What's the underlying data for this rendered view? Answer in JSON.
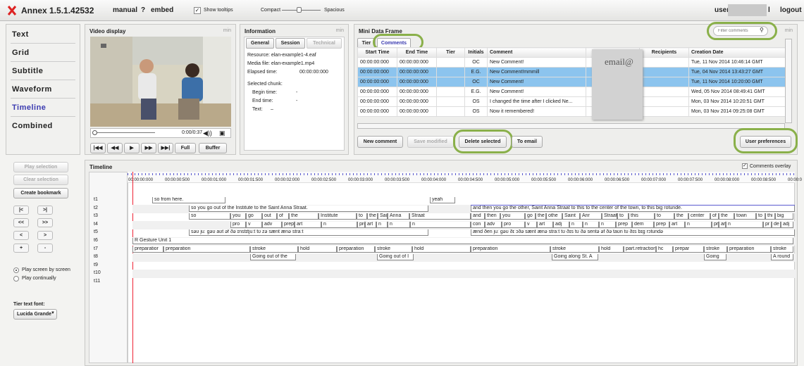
{
  "app": {
    "title": "Annex 1.5.1.42532",
    "manual": "manual",
    "help": "?",
    "embed": "embed",
    "show_tooltips": "Show tooltips",
    "compact": "Compact",
    "spacious": "Spacious",
    "user": "user",
    "user_suffix": "l",
    "logout": "logout"
  },
  "nav": [
    "Text",
    "Grid",
    "Subtitle",
    "Waveform",
    "Timeline",
    "Combined"
  ],
  "nav_active": "Timeline",
  "video": {
    "header": "Video display",
    "min": "min",
    "time": "0:00/0:37",
    "buttons": [
      "|◀◀",
      "◀◀",
      "▶",
      "▶▶",
      "▶▶|",
      "Full",
      "Buffer"
    ]
  },
  "info": {
    "header": "Information",
    "min": "min",
    "tabs": [
      "General",
      "Session",
      "Technical"
    ],
    "resource": "Resource:  elan-example1-4.eaf",
    "media": "Media file:  elan-example1.mp4",
    "elapsed_label": "Elapsed time:",
    "elapsed": "00:00:00:000",
    "chunk": "Selected chunk:",
    "begin": "Begin time:",
    "begin_val": "-",
    "end": "End time:",
    "end_val": "-",
    "text": "Text:",
    "text_val": "–"
  },
  "mdf": {
    "header": "Mini Data Frame",
    "min": "min",
    "filter_placeholder": "Filter comments",
    "tabs": [
      "Tier",
      "Comments"
    ],
    "columns": [
      "Start Time",
      "End Time",
      "Tier",
      "Initials",
      "Comment",
      "",
      "Recipients",
      "Creation Date"
    ],
    "rows": [
      [
        "00:00:00:000",
        "00:00:00:000",
        "",
        "OC",
        "New Comment!",
        "",
        "",
        "Tue, 11 Nov 2014 10:46:14 GMT"
      ],
      [
        "00:00:00:000",
        "00:00:00:000",
        "",
        "E.G.",
        "New Comment!mmmill",
        "",
        "",
        "Tue, 04 Nov 2014 13:43:27 GMT"
      ],
      [
        "00:00:00:000",
        "00:00:00:000",
        "",
        "OC",
        "New Comment!",
        "",
        "",
        "Tue, 11 Nov 2014 10:20:00 GMT"
      ],
      [
        "00:00:00:000",
        "00:00:00:000",
        "",
        "E.G.",
        "New Comment!",
        "",
        "",
        "Wed, 05 Nov 2014 08:49:41 GMT"
      ],
      [
        "00:00:00:000",
        "00:00:00:000",
        "",
        "OS",
        "I changed the time after I clicked Ne...",
        "",
        "",
        "Mon, 03 Nov 2014 10:20:51 GMT"
      ],
      [
        "00:00:00:000",
        "00:00:00:000",
        "",
        "OS",
        "Now it remembered!",
        "",
        "",
        "Mon, 03 Nov 2014 09:25:08 GMT"
      ]
    ],
    "tooltip": "email@",
    "buttons": {
      "new": "New comment",
      "save": "Save modified",
      "delete": "Delete selected",
      "email": "To email",
      "prefs": "User preferences"
    }
  },
  "left": {
    "play_selection": "Play selection",
    "clear_selection": "Clear selection",
    "create_bookmark": "Create bookmark",
    "nav_buttons": [
      "|<",
      ">|",
      "<<",
      ">>",
      "<",
      ">",
      "+",
      "-"
    ],
    "play_screen": "Play screen by screen",
    "play_cont": "Play continually",
    "font_label": "Tier text font:",
    "font_value": "Lucida Grande"
  },
  "timeline": {
    "header": "Timeline",
    "overlay": "Comments overlay",
    "ticks": [
      "00:00:00:000",
      "00:00:00:500",
      "00:00:01:000",
      "00:00:01:500",
      "00:00:02:000",
      "00:00:02:500",
      "00:00:03:000",
      "00:00:03:500",
      "00:00:04:000",
      "00:00:04:500",
      "00:00:05:000",
      "00:00:05:500",
      "00:00:06:000",
      "00:00:06:500",
      "00:00:07:000",
      "00:00:07:500",
      "00:00:08:000",
      "00:00:08:500",
      "00:00:0"
    ],
    "tiers": [
      "t1",
      "t2",
      "t3",
      "t4",
      "t5",
      "t6",
      "t7",
      "t8",
      "t9",
      "t10",
      "t11"
    ],
    "t1": [
      "so from here.",
      "yeah"
    ],
    "t2": [
      "so you go out of the Institute to the Saint Anna Straat.",
      "and then you go the other, Saint Anna Straat to this to the center of the town, to this big rotunde."
    ],
    "t3": [
      "so",
      "you",
      "go",
      "out",
      "of",
      "the",
      "Institute",
      "to",
      "the",
      "Sai",
      "Anna",
      "Straat",
      "and",
      "then",
      "you",
      "go",
      "the",
      "othe",
      "Saint",
      "Anr",
      "Straat",
      "to",
      "this",
      "to",
      "the",
      "center",
      "of",
      "the",
      "town",
      "to",
      "thi",
      "big"
    ],
    "t4": [
      "pro",
      "v",
      "adv",
      "prep",
      "art",
      "n",
      "pro",
      "art",
      "n",
      "n",
      "n",
      "con",
      "adv",
      "pro",
      "v",
      "art",
      "adj",
      "n",
      "n",
      "n",
      "prep",
      "dem",
      "prep",
      "art",
      "n",
      "pr",
      "art",
      "n",
      "pr",
      "de",
      "adj"
    ],
    "t5": [
      "səʊ juː gəʊ aʊt əf ðə ɪnstɪtjuːt tʊ zə sænt ænə straːt",
      "ænd ðen juː gəʊ ðɪ ɔðə sænt ænə straːt tʊ ðɪs tʊ ðə sentə əf ðə taʊn tʊ ðɪs bɪg rɔtundə"
    ],
    "t6": [
      "R Gesture Unit 1"
    ],
    "t7": [
      "preparatior",
      "preparation",
      "stroke",
      "hold",
      "preparation",
      "stroke",
      "hold",
      "preparation",
      "stroke",
      "hold",
      "part.retraction",
      "hc",
      "prepar",
      "stroke",
      "preparation",
      "stroke"
    ],
    "t8": [
      "Going out of the",
      "Going out of I",
      "Going along St. A",
      "Going",
      "A round"
    ]
  },
  "colors": {
    "accent": "#3a3ab0",
    "selected_row": "#8cc4ee",
    "highlight_ring": "#8ab04a",
    "playhead": "#e23"
  }
}
